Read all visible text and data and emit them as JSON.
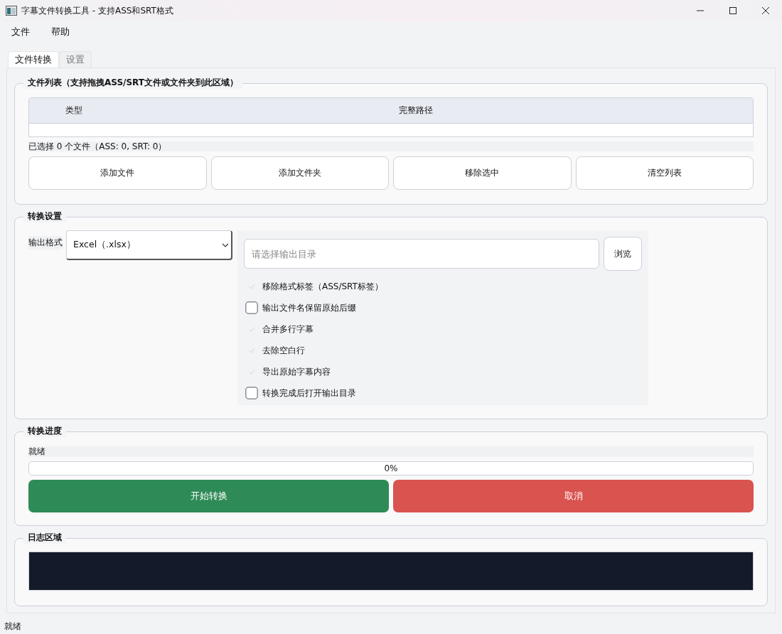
{
  "window": {
    "title": "字幕文件转换工具 - 支持ASS和SRT格式"
  },
  "menu": [
    "文件",
    "帮助"
  ],
  "tabs": [
    {
      "label": "文件转换",
      "selected": true
    },
    {
      "label": "设置",
      "selected": false
    }
  ],
  "file_list": {
    "title": "文件列表（支持拖拽ASS/SRT文件或文件夹到此区域）",
    "columns": [
      "类型",
      "完整路径"
    ],
    "summary": "已选择 0 个文件（ASS: 0, SRT: 0）",
    "buttons": [
      "添加文件",
      "添加文件夹",
      "移除选中",
      "清空列表"
    ]
  },
  "settings": {
    "title": "转换设置",
    "format_label": "输出格式",
    "format_value": "Excel（.xlsx）",
    "output_dir": {
      "placeholder": "请选择输出目录"
    },
    "browse": "浏览",
    "options": [
      {
        "label": "移除格式标签（ASS/SRT标签）",
        "checked": true
      },
      {
        "label": "输出文件名保留原始后缀",
        "checked": false
      },
      {
        "label": "合并多行字幕",
        "checked": true
      },
      {
        "label": "去除空白行",
        "checked": true
      },
      {
        "label": "导出原始字幕内容",
        "checked": true
      },
      {
        "label": "转换完成后打开输出目录",
        "checked": false
      }
    ]
  },
  "progress": {
    "title": "转换进度",
    "status": "就绪",
    "level": 0,
    "reading": "0%",
    "start": "开始转换",
    "cancel": "取消"
  },
  "log": {
    "title": "日志区域"
  },
  "status_bar": "就绪"
}
